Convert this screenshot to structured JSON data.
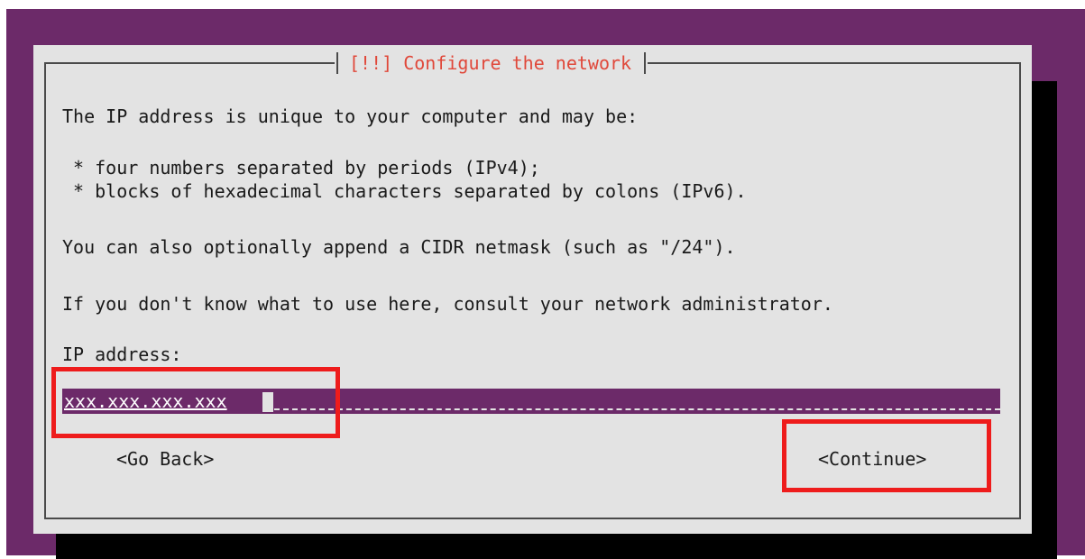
{
  "dialog": {
    "title": "[!!] Configure the network",
    "intro": "The IP address is unique to your computer and may be:",
    "bullets": [
      " * four numbers separated by periods (IPv4);",
      " * blocks of hexadecimal characters separated by colons (IPv6)."
    ],
    "cidr_note": "You can also optionally append a CIDR netmask (such as \"/24\").",
    "consult_note": "If you don't know what to use here, consult your network administrator.",
    "field_label": "IP address:",
    "field_value": "xxx.xxx.xxx.xxx",
    "go_back_label": "<Go Back>",
    "continue_label": "<Continue>"
  },
  "colors": {
    "background": "#6c2a69",
    "dialog": "#e3e3e3",
    "title": "#e0483a",
    "highlight_box": "#ee1c1c"
  }
}
